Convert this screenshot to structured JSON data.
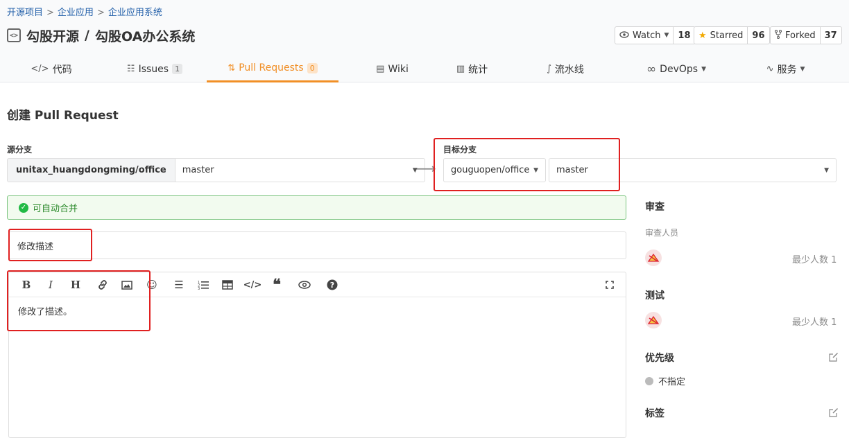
{
  "breadcrumb": [
    "开源项目",
    "企业应用",
    "企业应用系统"
  ],
  "breadcrumb_sep": ">",
  "repo": {
    "owner": "勾股开源",
    "slash": "/",
    "name": "勾股OA办公系统",
    "icon": "code-square-icon"
  },
  "stats": {
    "watch": {
      "label": "Watch",
      "count": "18"
    },
    "star": {
      "label": "Starred",
      "count": "96"
    },
    "fork": {
      "label": "Forked",
      "count": "37"
    }
  },
  "tabs": [
    {
      "label": "代码",
      "icon": "code-icon"
    },
    {
      "label": "Issues",
      "badge": "1",
      "icon": "issues-icon"
    },
    {
      "label": "Pull Requests",
      "badge": "0",
      "icon": "pull-request-icon"
    },
    {
      "label": "Wiki",
      "icon": "book-icon"
    },
    {
      "label": "统计",
      "icon": "chart-icon"
    },
    {
      "label": "流水线",
      "icon": "pipeline-icon"
    },
    {
      "label": "DevOps",
      "icon": "infinity-icon"
    },
    {
      "label": "服务",
      "icon": "pulse-icon"
    }
  ],
  "page_title": "创建 Pull Request",
  "source": {
    "label": "源分支",
    "repo": "unitax_huangdongming/office",
    "branch": "master"
  },
  "target": {
    "label": "目标分支",
    "repo": "gouguopen/office",
    "branch": "master"
  },
  "merge_status": "可自动合并",
  "pr_title": "修改描述",
  "pr_body": "修改了描述。",
  "sidebar": {
    "review": {
      "title": "审查",
      "sub": "审查人员",
      "min": "最少人数 1"
    },
    "test": {
      "title": "测试",
      "min": "最少人数 1"
    },
    "priority": {
      "title": "优先级",
      "value": "不指定"
    },
    "labels": {
      "title": "标签"
    }
  },
  "colors": {
    "accent": "#f18f26",
    "highlight": "#e02020",
    "success": "#21ba45"
  }
}
